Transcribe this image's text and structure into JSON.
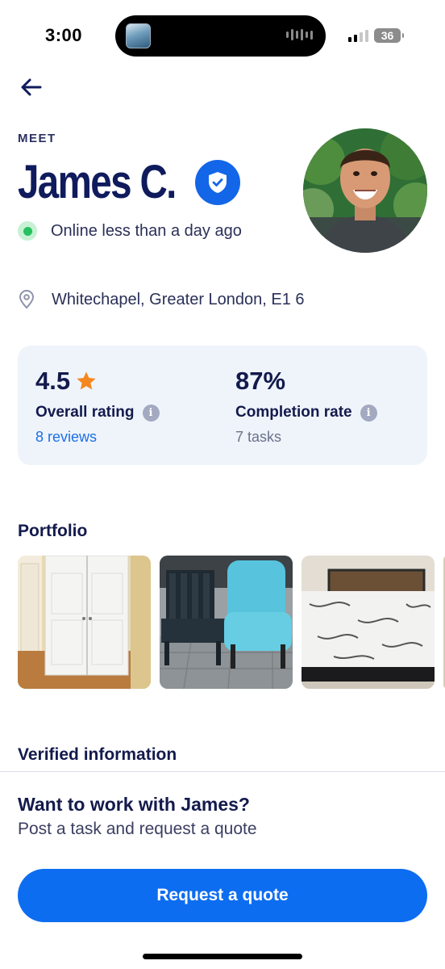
{
  "status_bar": {
    "time": "3:00",
    "battery": "36"
  },
  "header": {
    "back_icon": "arrow-left-icon",
    "meet_label": "MEET",
    "name": "James C.",
    "verified_icon": "shield-check-icon",
    "online_status": "Online less than a day ago"
  },
  "location": {
    "icon": "map-pin-icon",
    "text": "Whitechapel, Greater London, E1 6"
  },
  "stats": {
    "rating": {
      "value": "4.5",
      "label": "Overall rating",
      "sub": "8 reviews"
    },
    "completion": {
      "value": "87%",
      "label": "Completion rate",
      "sub": "7 tasks"
    }
  },
  "portfolio": {
    "title": "Portfolio",
    "items": [
      "wardrobe-photo",
      "garden-chairs-photo",
      "bed-mattress-photo"
    ]
  },
  "verified_section": {
    "title": "Verified information"
  },
  "cta": {
    "title": "Want to work with James?",
    "subtitle": "Post a task and request a quote",
    "button_label": "Request a quote"
  },
  "colors": {
    "brand_blue": "#0d6df0",
    "navy_text": "#131a4c",
    "online_green": "#26c060",
    "star_orange": "#f5871f",
    "card_bg": "#eff4fb"
  }
}
